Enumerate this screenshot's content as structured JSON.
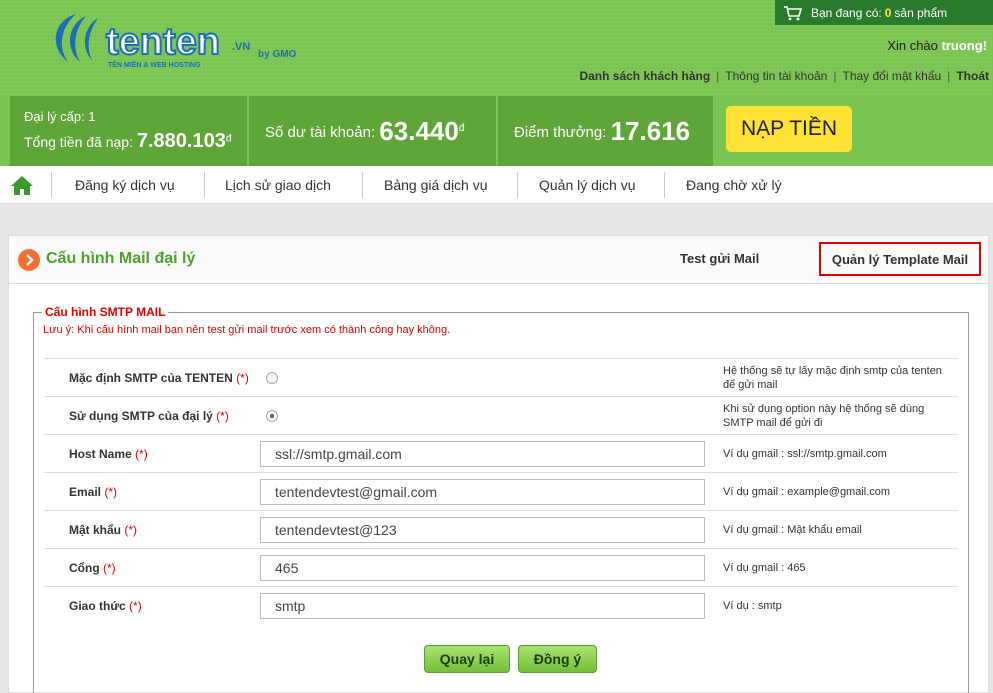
{
  "brand": {
    "logo_text": "tenten",
    "logo_domain": ".VN",
    "logo_tagline": "TÊN MIỀN & WEB HOSTING",
    "logo_partner": "by GMO"
  },
  "cart": {
    "prefix": "Bạn đang có:",
    "count": "0",
    "suffix": "sản phẩm"
  },
  "greeting": {
    "prefix": "Xin chào",
    "name": "truong!"
  },
  "toplinks": [
    "Danh sách khách hàng",
    "Thông tin tài khoản",
    "Thay đổi mật khẩu",
    "Thoát"
  ],
  "stats": {
    "agent_level_label": "Đại lý cấp: 1",
    "total_label": "Tổng tiền đã nạp:",
    "total_value": "7.880.103",
    "balance_label": "Số dư tài khoản:",
    "balance_value": "63.440",
    "points_label": "Điểm thưởng:",
    "points_value": "17.616",
    "currency": "đ"
  },
  "topup_button": "NẠP TIỀN",
  "nav": [
    "Đăng ký dịch vụ",
    "Lịch sử giao dịch",
    "Bảng giá dịch vụ",
    "Quản lý dịch vụ",
    "Đang chờ xử lý"
  ],
  "card": {
    "title": "Cấu hình Mail đại lý",
    "tab_test": "Test gửi Mail",
    "tab_templates": "Quản lý Template Mail"
  },
  "form": {
    "legend": "Cấu hình SMTP MAIL",
    "note": "Lưu ý: Khi cấu hình mail bạn nên test gửi mail trước xem có thành công hay không.",
    "required_mark": "(*)",
    "rows": [
      {
        "label": "Mặc định SMTP của TENTEN",
        "hint": "Hệ thống sẽ tự lấy mặc định smtp của tenten để gửi mail"
      },
      {
        "label": "Sử dụng SMTP của đại lý",
        "hint": "Khi sử dụng option này hệ thống sẽ dùng SMTP mail để gửi đi"
      },
      {
        "label": "Host Name",
        "value": "ssl://smtp.gmail.com",
        "hint": "Ví dụ gmail : ssl://smtp.gmail.com"
      },
      {
        "label": "Email",
        "value": "tentendevtest@gmail.com",
        "hint": "Ví dụ gmail : example@gmail.com"
      },
      {
        "label": "Mật khẩu",
        "value": "tentendevtest@123",
        "hint": "Ví dụ gmail : Mật khẩu email"
      },
      {
        "label": "Cổng",
        "value": "465",
        "hint": "Ví dụ gmail : 465"
      },
      {
        "label": "Giao thức",
        "value": "smtp",
        "hint": "Ví dụ : smtp"
      }
    ],
    "back_button": "Quay lại",
    "submit_button": "Đồng ý"
  },
  "colors": {
    "header_green": "#7dc553",
    "stat_green": "#5fa638",
    "title_green": "#4aa12b",
    "required_red": "#dd0000",
    "topup_yellow": "#ffe233"
  }
}
